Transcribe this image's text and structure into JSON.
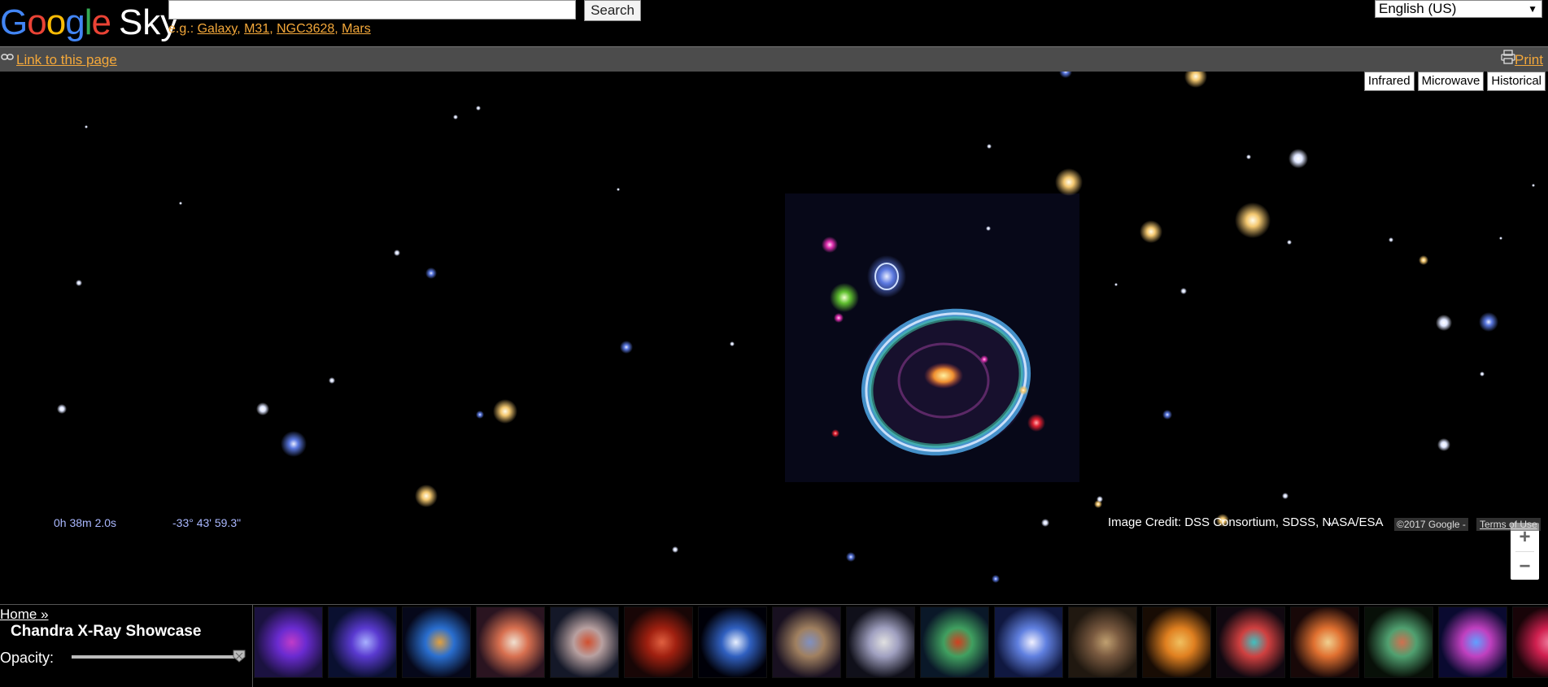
{
  "header": {
    "logo_letters": [
      "G",
      "o",
      "o",
      "g",
      "l",
      "e"
    ],
    "logo_sky": "Sky",
    "search_value": "",
    "search_button": "Search",
    "examples_prefix": "e.g.:",
    "examples": [
      "Galaxy",
      "M31",
      "NGC3628",
      "Mars"
    ],
    "language": "English (US)"
  },
  "linkbar": {
    "link_label": "Link to this page",
    "print_label": "Print"
  },
  "layers": [
    "Infrared",
    "Microwave",
    "Historical"
  ],
  "zoom": {
    "in": "+",
    "out": "−"
  },
  "status": {
    "ra": "0h 38m 2.0s",
    "dec": "-33° 43' 59.3\"",
    "credit": "Image Credit: DSS Consortium, SDSS, NASA/ESA",
    "copyright": "©2017 Google -",
    "terms": "Terms of Use"
  },
  "panel": {
    "home": "Home »",
    "title": "Chandra X-Ray Showcase",
    "opacity_label": "Opacity:",
    "opacity_value": 1.0
  },
  "thumbnails": [
    {
      "name": "thumb-1",
      "colors": [
        "#1b1240",
        "#6a2bd0",
        "#c03cc8"
      ]
    },
    {
      "name": "thumb-2",
      "colors": [
        "#0a1030",
        "#5a3ad0",
        "#a8b0ff"
      ]
    },
    {
      "name": "thumb-3",
      "colors": [
        "#06081a",
        "#2a6fd0",
        "#e0a040"
      ]
    },
    {
      "name": "thumb-4",
      "colors": [
        "#2a1420",
        "#d87050",
        "#f0e0d0"
      ]
    },
    {
      "name": "thumb-5",
      "colors": [
        "#141828",
        "#b8a0a0",
        "#d05030"
      ]
    },
    {
      "name": "thumb-6",
      "colors": [
        "#180606",
        "#a02010",
        "#e06040"
      ]
    },
    {
      "name": "thumb-7",
      "colors": [
        "#000008",
        "#3060c0",
        "#e8f0ff"
      ]
    },
    {
      "name": "thumb-8",
      "colors": [
        "#181020",
        "#a08060",
        "#8090c0"
      ]
    },
    {
      "name": "thumb-9",
      "colors": [
        "#10101a",
        "#a0a0c0",
        "#e0e0e0"
      ]
    },
    {
      "name": "thumb-10",
      "colors": [
        "#0a1828",
        "#40a060",
        "#d04020"
      ]
    },
    {
      "name": "thumb-11",
      "colors": [
        "#101840",
        "#6080e0",
        "#f0f0ff"
      ]
    },
    {
      "name": "thumb-12",
      "colors": [
        "#201810",
        "#7a5a40",
        "#c0a070"
      ]
    },
    {
      "name": "thumb-13",
      "colors": [
        "#180c04",
        "#e08020",
        "#f0c060"
      ]
    },
    {
      "name": "thumb-14",
      "colors": [
        "#100810",
        "#d04040",
        "#40c0c0"
      ]
    },
    {
      "name": "thumb-15",
      "colors": [
        "#180808",
        "#e07030",
        "#f0d090"
      ]
    },
    {
      "name": "thumb-16",
      "colors": [
        "#081008",
        "#50a070",
        "#d07050"
      ]
    },
    {
      "name": "thumb-17",
      "colors": [
        "#0a0a30",
        "#c040c0",
        "#60a0ff"
      ]
    },
    {
      "name": "thumb-18",
      "colors": [
        "#180408",
        "#d02050",
        "#f080a0"
      ]
    }
  ],
  "colors": {
    "link": "#f4a83a",
    "linkbar_bg": "#4c4c4c",
    "coords_text": "#aab8ff"
  }
}
